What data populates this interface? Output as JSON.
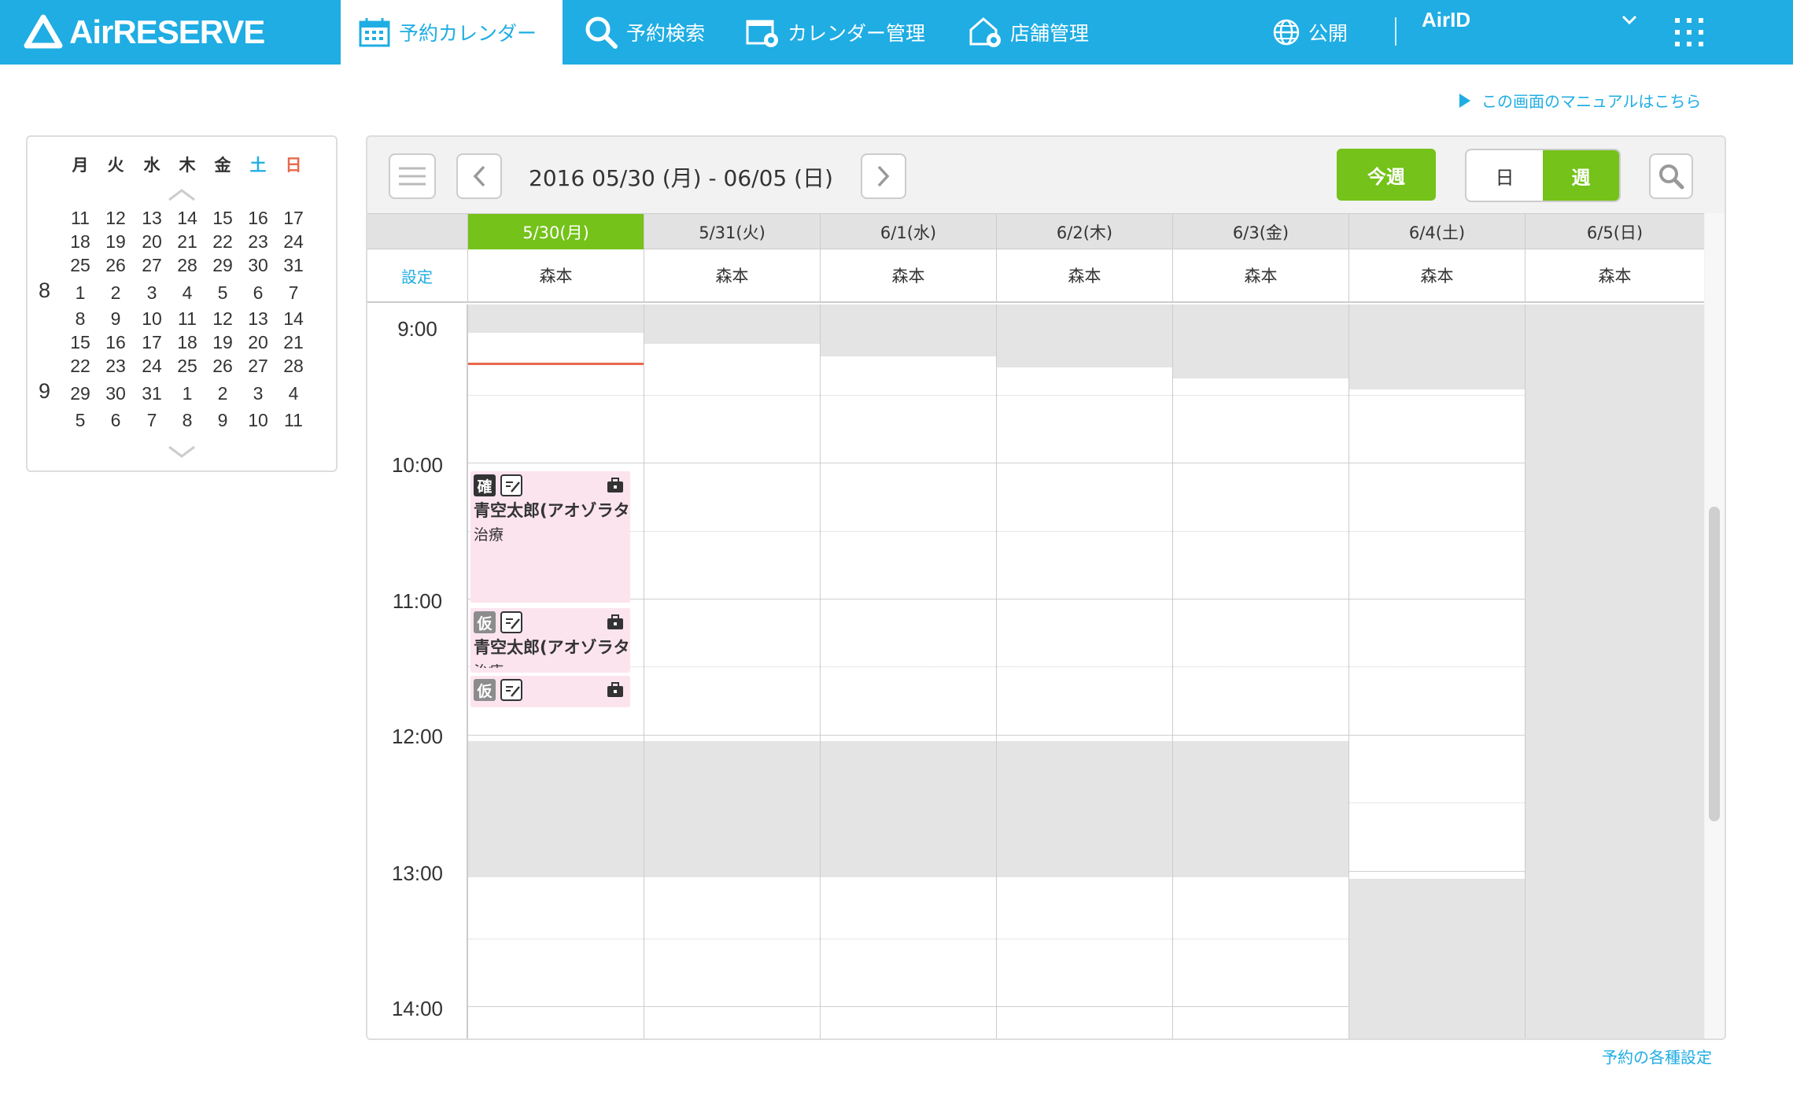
{
  "app": {
    "logo": "AirRESERVE"
  },
  "nav": {
    "calendar": "予約カレンダー",
    "search": "予約検索",
    "cal_manage": "カレンダー管理",
    "shop_manage": "店舗管理",
    "public": "公開",
    "airid": "AirID"
  },
  "manual_link": "この画面のマニュアルはこちら",
  "mini_calendar": {
    "dow": [
      "月",
      "火",
      "水",
      "木",
      "金",
      "土",
      "日"
    ],
    "month_labels": [
      "8",
      "9"
    ],
    "rows": [
      [
        "11",
        "12",
        "13",
        "14",
        "15",
        "16",
        "17"
      ],
      [
        "18",
        "19",
        "20",
        "21",
        "22",
        "23",
        "24"
      ],
      [
        "25",
        "26",
        "27",
        "28",
        "29",
        "30",
        "31"
      ],
      [
        "1",
        "2",
        "3",
        "4",
        "5",
        "6",
        "7"
      ],
      [
        "8",
        "9",
        "10",
        "11",
        "12",
        "13",
        "14"
      ],
      [
        "15",
        "16",
        "17",
        "18",
        "19",
        "20",
        "21"
      ],
      [
        "22",
        "23",
        "24",
        "25",
        "26",
        "27",
        "28"
      ],
      [
        "29",
        "30",
        "31",
        "1",
        "2",
        "3",
        "4"
      ],
      [
        "5",
        "6",
        "7",
        "8",
        "9",
        "10",
        "11"
      ]
    ]
  },
  "toolbar": {
    "range": "2016 05/30 (月) - 06/05 (日)",
    "this_week": "今週",
    "day": "日",
    "week": "週"
  },
  "columns": [
    {
      "date": "5/30(月)",
      "staff": "森本"
    },
    {
      "date": "5/31(火)",
      "staff": "森本"
    },
    {
      "date": "6/1(水)",
      "staff": "森本"
    },
    {
      "date": "6/2(木)",
      "staff": "森本"
    },
    {
      "date": "6/3(金)",
      "staff": "森本"
    },
    {
      "date": "6/4(土)",
      "staff": "森本"
    },
    {
      "date": "6/5(日)",
      "staff": "森本"
    }
  ],
  "settings_label": "設定",
  "times": [
    "9:00",
    "10:00",
    "11:00",
    "12:00",
    "13:00",
    "14:00"
  ],
  "events": [
    {
      "badge": "確",
      "name": "青空太郎(アオゾラタ",
      "menu": "治療"
    },
    {
      "badge": "仮",
      "name": "青空太郎(アオゾラタ",
      "menu": "治療"
    },
    {
      "badge": "仮",
      "name": "",
      "menu": ""
    }
  ],
  "footer_link": "予約の各種設定",
  "colors": {
    "brand": "#1fade3",
    "accent": "#74c21a",
    "event": "#fce4ef",
    "confirmed": "#333333",
    "tentative": "#8c8c8c",
    "now_line": "#e8684a"
  }
}
